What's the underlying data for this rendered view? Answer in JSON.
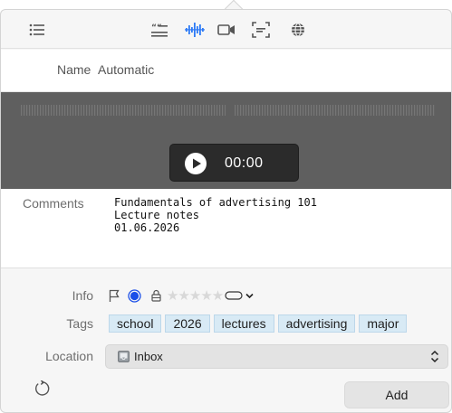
{
  "toolbar": {
    "icons": [
      "list-icon",
      "text-format-icon",
      "waveform-icon",
      "video-icon",
      "screenshot-icon",
      "web-icon"
    ],
    "active_color": "#2f7bf6"
  },
  "name_row": {
    "label": "Name",
    "value": "Automatic"
  },
  "player": {
    "time": "00:00"
  },
  "comments": {
    "label": "Comments",
    "lines": [
      "Fundamentals of advertising 101",
      "Lecture notes",
      "01.06.2026"
    ]
  },
  "info": {
    "label": "Info",
    "flagged": false,
    "unread_dot_color": "#1a4fe8",
    "locked": false,
    "rating": 0,
    "rating_max": 5
  },
  "tags": {
    "label": "Tags",
    "items": [
      "school",
      "2026",
      "lectures",
      "advertising",
      "major"
    ]
  },
  "location": {
    "label": "Location",
    "value": "Inbox"
  },
  "actions": {
    "add_label": "Add"
  }
}
